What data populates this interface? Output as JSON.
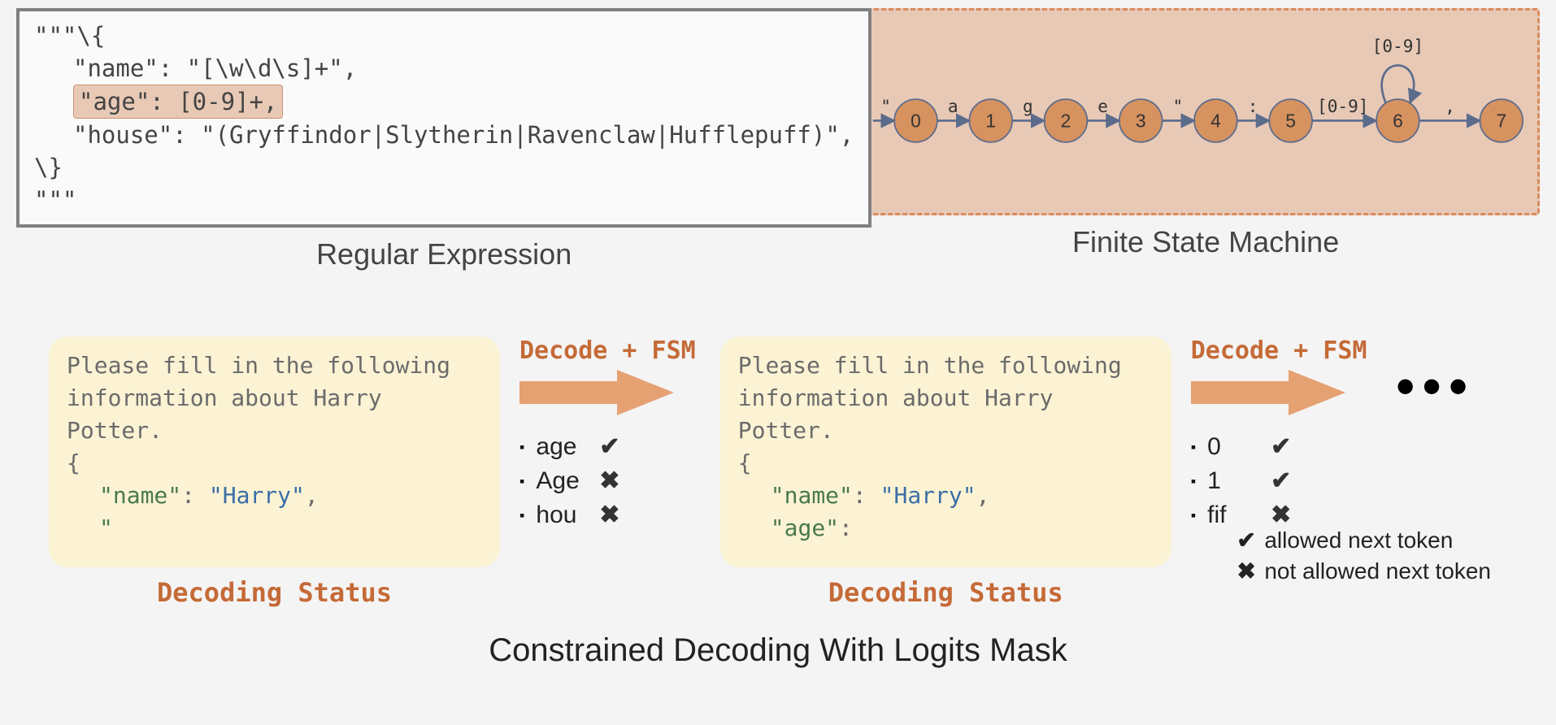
{
  "regex": {
    "title": "Regular Expression",
    "l1": "\"\"\"\\{",
    "l2": "\"name\": \"[\\w\\d\\s]+\",",
    "l3": "\"age\": [0-9]+,",
    "l4": "\"house\": \"(Gryffindor|Slytherin|Ravenclaw|Hufflepuff)\",",
    "l5": "\\}",
    "l6": "\"\"\""
  },
  "fsm": {
    "title": "Finite State Machine",
    "nodes": [
      "0",
      "1",
      "2",
      "3",
      "4",
      "5",
      "6",
      "7"
    ],
    "edges": [
      "\"",
      "a",
      "g",
      "e",
      "\"",
      ":",
      "[0-9]",
      ","
    ],
    "loop_label": "[0-9]"
  },
  "bottom_title": "Constrained Decoding With Logits Mask",
  "decoding_status_label": "Decoding Status",
  "decode_fsm_label": "Decode + FSM",
  "card1": {
    "line1": "Please fill in the following",
    "line2": "information about Harry Potter.",
    "brace_open": "{",
    "k_name": "\"name\"",
    "colon1": ": ",
    "v_name": "\"Harry\"",
    "comma1": ",",
    "tail": "\""
  },
  "choices1": [
    {
      "tok": "age",
      "ok": true
    },
    {
      "tok": "Age",
      "ok": false
    },
    {
      "tok": "hou",
      "ok": false
    }
  ],
  "card2": {
    "line1": "Please fill in the following",
    "line2": "information about Harry Potter.",
    "brace_open": "{",
    "k_name": "\"name\"",
    "colon1": ": ",
    "v_name": "\"Harry\"",
    "comma1": ",",
    "k_age": "\"age\"",
    "colon2": ":"
  },
  "choices2": [
    {
      "tok": "0",
      "ok": true
    },
    {
      "tok": "1",
      "ok": true
    },
    {
      "tok": "fif",
      "ok": false
    }
  ],
  "legend": {
    "ok": "allowed next token",
    "no": "not allowed next token"
  },
  "icons": {
    "check": "✔",
    "cross": "✖",
    "dots": "•••"
  }
}
